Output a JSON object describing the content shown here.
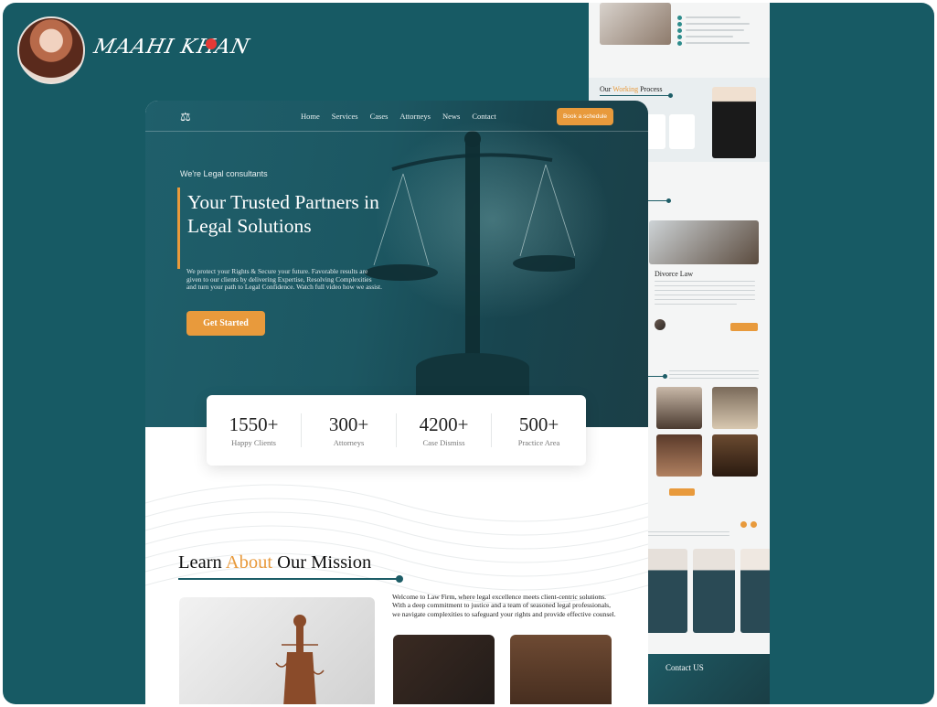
{
  "author": {
    "signature": "MAAHI KHAN"
  },
  "nav": {
    "logo": "⚖",
    "links": [
      "Home",
      "Services",
      "Cases",
      "Attorneys",
      "News",
      "Contact"
    ],
    "cta": "Book a schedule"
  },
  "hero": {
    "tagline": "We're Legal consultants",
    "title": "Your Trusted Partners in Legal Solutions",
    "description": "We protect your Rights & Secure your future. Favorable results are given to our clients by delivering Expertise, Resolving Complexities and turn your path to Legal Confidence. Watch full video how we assist.",
    "button": "Get Started"
  },
  "stats": [
    {
      "value": "1550+",
      "label": "Happy Clients"
    },
    {
      "value": "300+",
      "label": "Attorneys"
    },
    {
      "value": "4200+",
      "label": "Case Dismiss"
    },
    {
      "value": "500+",
      "label": "Practice Area"
    }
  ],
  "mission": {
    "title_pre": "Learn ",
    "title_accent": "About",
    "title_post": " Our Mission",
    "text": "Welcome to Law Firm, where legal excellence meets client-centric solutions. With a deep commitment to justice and a team of seasoned legal professionals, we navigate complexities to safeguard your rights and provide effective counsel."
  },
  "back_page": {
    "process_title_pre": "Our ",
    "process_title_accent": "Working",
    "process_title_post": " Process",
    "case_title": "Divorce Law",
    "contact_title": "Contact US"
  },
  "colors": {
    "background": "#175a64",
    "accent": "#e89a3c",
    "hero": "#1c5762"
  }
}
